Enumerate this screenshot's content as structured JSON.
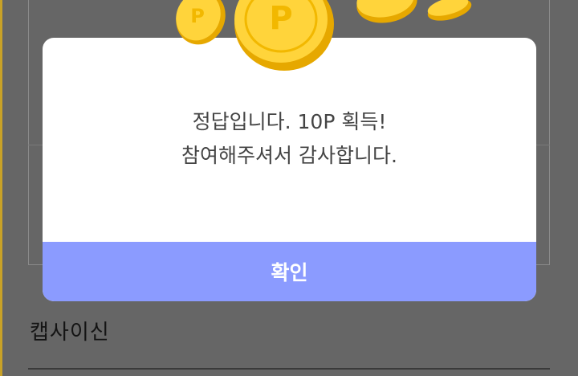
{
  "background": {
    "label": "캡사이신"
  },
  "modal": {
    "line1": "정답입니다. 10P 획득!",
    "line2": "참여해주셔서 감사합니다.",
    "confirm_label": "확인"
  },
  "coins": {
    "glyph": "P",
    "icon": "gold-coin-icon"
  },
  "colors": {
    "overlay": "#666666",
    "button": "#8b9bff",
    "coin": "#ffd43b",
    "coin_dark": "#e6a800"
  }
}
